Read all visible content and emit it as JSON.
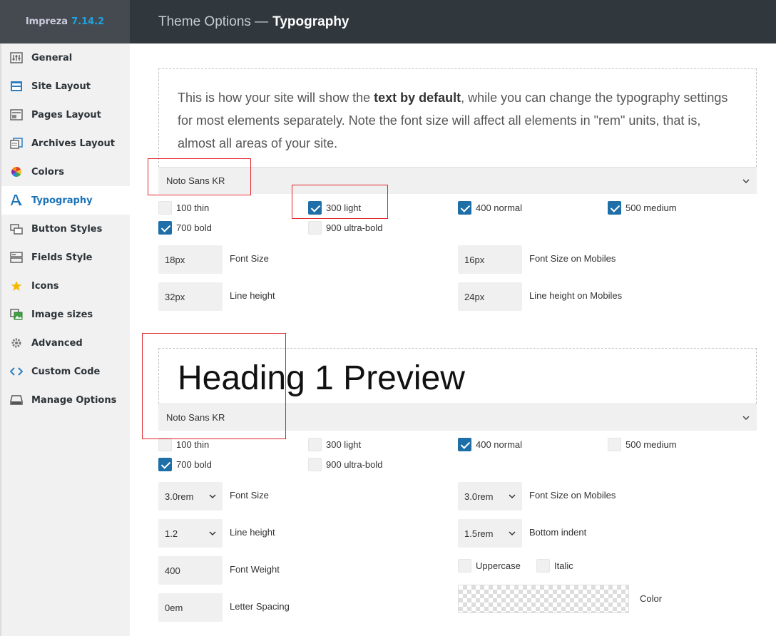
{
  "brand": {
    "name": "Impreza",
    "version": "7.14.2"
  },
  "header": {
    "prefix": "Theme Options —",
    "title": "Typography"
  },
  "sidebar": {
    "items": [
      {
        "label": "General",
        "icon": "sliders-icon"
      },
      {
        "label": "Site Layout",
        "icon": "layout-icon"
      },
      {
        "label": "Pages Layout",
        "icon": "page-layout-icon"
      },
      {
        "label": "Archives Layout",
        "icon": "archives-icon"
      },
      {
        "label": "Colors",
        "icon": "color-wheel-icon"
      },
      {
        "label": "Typography",
        "icon": "typography-icon"
      },
      {
        "label": "Button Styles",
        "icon": "button-icon"
      },
      {
        "label": "Fields Style",
        "icon": "fields-icon"
      },
      {
        "label": "Icons",
        "icon": "star-icon"
      },
      {
        "label": "Image sizes",
        "icon": "image-icon"
      },
      {
        "label": "Advanced",
        "icon": "gear-icon"
      },
      {
        "label": "Custom Code",
        "icon": "code-icon"
      },
      {
        "label": "Manage Options",
        "icon": "hdd-icon"
      }
    ],
    "active": "Typography"
  },
  "body_text": {
    "intro_before": "This is how your site will show the ",
    "intro_bold": "text by default",
    "intro_after": ", while you can change the typography settings for most elements separately. Note the font size will affect all elements in \"rem\" units, that is, almost all areas of your site.",
    "font": "Noto Sans KR",
    "weights": {
      "w100": {
        "label": "100 thin",
        "checked": false
      },
      "w300": {
        "label": "300 light",
        "checked": true
      },
      "w400": {
        "label": "400 normal",
        "checked": true
      },
      "w500": {
        "label": "500 medium",
        "checked": true
      },
      "w700": {
        "label": "700 bold",
        "checked": true
      },
      "w900": {
        "label": "900 ultra-bold",
        "checked": false
      }
    },
    "font_size": {
      "value": "18px",
      "label": "Font Size"
    },
    "font_size_mobile": {
      "value": "16px",
      "label": "Font Size on Mobiles"
    },
    "line_height": {
      "value": "32px",
      "label": "Line height"
    },
    "line_height_mobile": {
      "value": "24px",
      "label": "Line height on Mobiles"
    }
  },
  "heading1": {
    "preview": "Heading 1 Preview",
    "font": "Noto Sans KR",
    "weights": {
      "w100": {
        "label": "100 thin",
        "checked": false
      },
      "w300": {
        "label": "300 light",
        "checked": false
      },
      "w400": {
        "label": "400 normal",
        "checked": true
      },
      "w500": {
        "label": "500 medium",
        "checked": false
      },
      "w700": {
        "label": "700 bold",
        "checked": true
      },
      "w900": {
        "label": "900 ultra-bold",
        "checked": false
      }
    },
    "font_size": {
      "value": "3.0rem",
      "label": "Font Size"
    },
    "font_size_mobile": {
      "value": "3.0rem",
      "label": "Font Size on Mobiles"
    },
    "line_height": {
      "value": "1.2",
      "label": "Line height"
    },
    "bottom_indent": {
      "value": "1.5rem",
      "label": "Bottom indent"
    },
    "font_weight": {
      "value": "400",
      "label": "Font Weight"
    },
    "letter_spacing": {
      "value": "0em",
      "label": "Letter Spacing"
    },
    "uppercase": {
      "label": "Uppercase",
      "checked": false
    },
    "italic": {
      "label": "Italic",
      "checked": false
    },
    "color": {
      "label": "Color"
    }
  },
  "colors": {
    "accent": "#1e6fa8",
    "highlight": "#e0242b",
    "topbar": "#30373d"
  }
}
